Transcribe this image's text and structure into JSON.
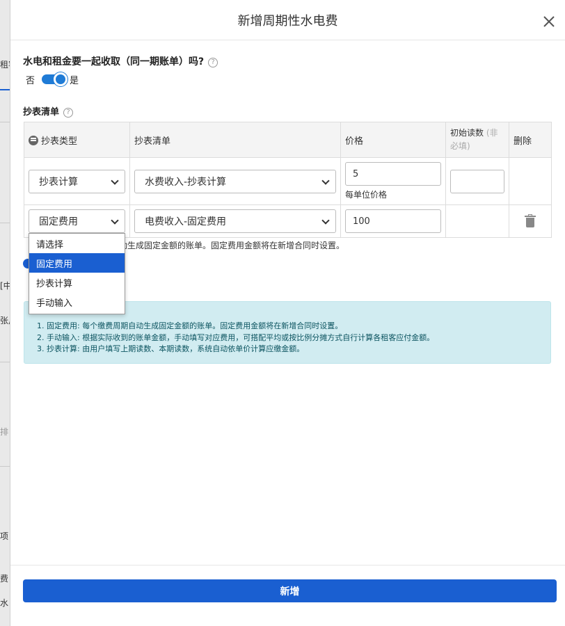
{
  "background": {
    "fragments": [
      "租客",
      "[中",
      "张户",
      "排",
      "项",
      "费",
      "水"
    ]
  },
  "modal": {
    "title": "新增周期性水电费",
    "question": "水电和租金要一起收取（同一期账单）吗?",
    "toggle": {
      "off_label": "否",
      "on_label": "是",
      "value": true
    },
    "section_label": "抄表清单",
    "table": {
      "headers": [
        "抄表类型",
        "抄表清单",
        "价格",
        "初始读数",
        "删除"
      ],
      "header_note": "(非必填)",
      "rows": [
        {
          "type": "抄表计算",
          "item": "水费收入-抄表计算",
          "price": "5",
          "unit_label": "每单位价格",
          "initial_reading": ""
        },
        {
          "type": "固定费用",
          "item": "电费收入-固定费用",
          "price": "100"
        }
      ]
    },
    "row_description": "动生成固定金额的账单。固定费用金额将在新增合同时设置。",
    "dropdown": {
      "options": [
        "请选择",
        "固定费用",
        "抄表计算",
        "手动输入"
      ],
      "selected": "固定费用"
    },
    "info": [
      "1. 固定费用: 每个缴费周期自动生成固定金额的账单。固定费用金额将在新增合同时设置。",
      "2. 手动输入: 根据实际收到的账单金额，手动填写对应费用，可搭配平均或按比例分摊方式自行计算各租客应付金额。",
      "3. 抄表计算: 由用户填写上期读数、本期读数，系统自动依单价计算应缴金额。"
    ],
    "submit_label": "新增"
  },
  "colors": {
    "primary": "#1a5fd1",
    "info_bg": "#d1ecf1",
    "info_text": "#0c5460"
  }
}
